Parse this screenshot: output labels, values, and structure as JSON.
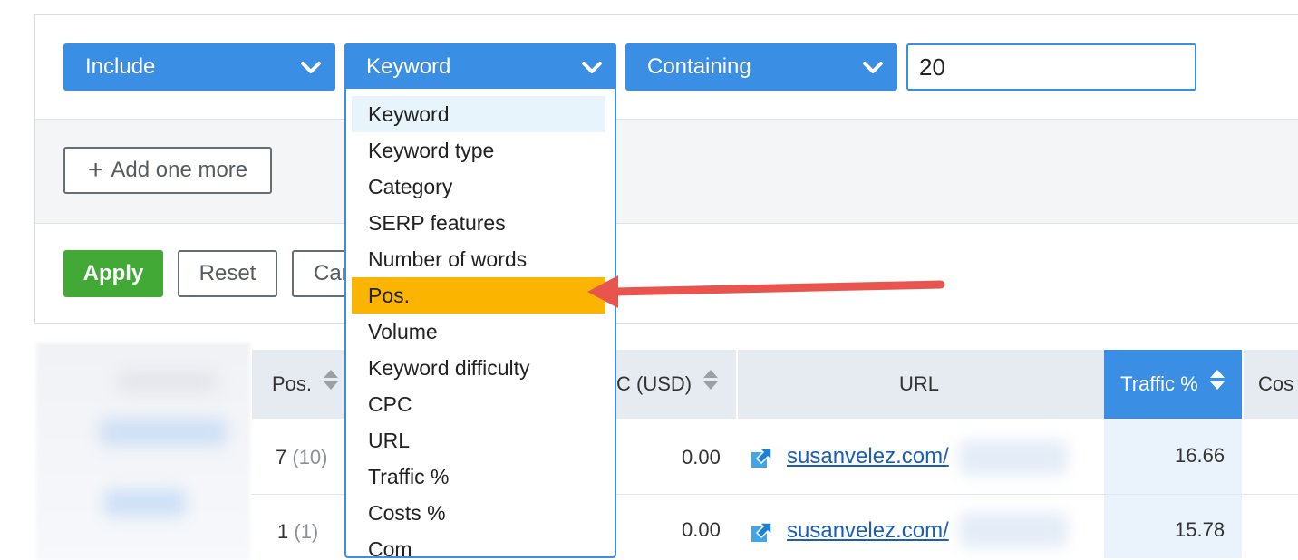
{
  "filter": {
    "include_label": "Include",
    "field_label": "Keyword",
    "condition_label": "Containing",
    "value": "20",
    "add_more_label": "Add one more",
    "apply_label": "Apply",
    "reset_label": "Reset",
    "cancel_label_partial": "Car"
  },
  "menu": {
    "items": [
      "Keyword",
      "Keyword type",
      "Category",
      "SERP features",
      "Number of words",
      "Pos.",
      "Volume",
      "Keyword difficulty",
      "CPC",
      "URL",
      "Traffic %",
      "Costs %",
      "Com"
    ],
    "hovered_index": 0,
    "highlighted_index": 5
  },
  "table": {
    "headers": {
      "pos": "Pos.",
      "cpc": "C (USD)",
      "url": "URL",
      "traffic": "Traffic %",
      "costs": "Cos"
    },
    "rows": [
      {
        "pos": "7",
        "prev": "(10)",
        "cpc": "0.00",
        "url": "susanvelez.com/",
        "traffic": "16.66"
      },
      {
        "pos": "1",
        "prev": "(1)",
        "cpc": "0.00",
        "url": "susanvelez.com/",
        "traffic": "15.78"
      }
    ]
  },
  "colors": {
    "primary": "#3a8ee3",
    "apply": "#42a836",
    "highlight": "#fbb400",
    "arrow": "#e8554e"
  }
}
